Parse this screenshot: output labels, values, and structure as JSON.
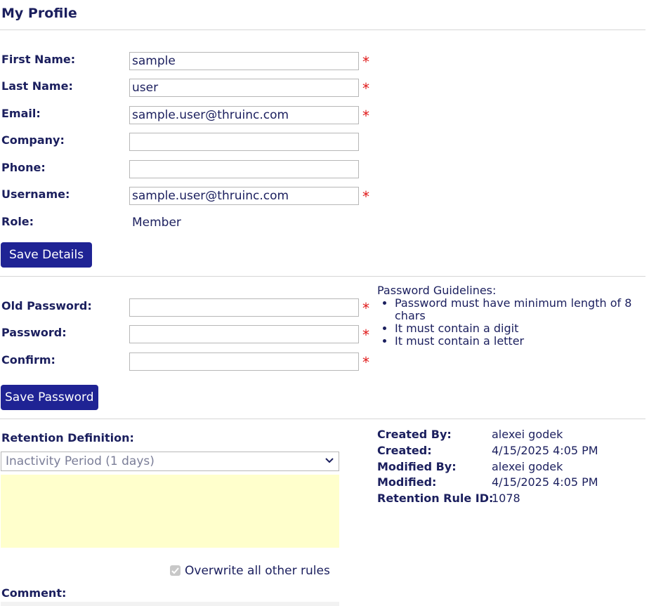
{
  "page": {
    "title": "My Profile"
  },
  "profile": {
    "first_name": {
      "label": "First Name:",
      "value": "sample"
    },
    "last_name": {
      "label": "Last Name:",
      "value": "user"
    },
    "email": {
      "label": "Email:",
      "value": "sample.user@thruinc.com"
    },
    "company": {
      "label": "Company:",
      "value": ""
    },
    "phone": {
      "label": "Phone:",
      "value": ""
    },
    "username": {
      "label": "Username:",
      "value": "sample.user@thruinc.com"
    },
    "role": {
      "label": "Role:",
      "value": "Member"
    },
    "required_mark": "*",
    "save_label": "Save Details"
  },
  "password": {
    "old": {
      "label": "Old Password:",
      "value": ""
    },
    "new": {
      "label": "Password:",
      "value": ""
    },
    "confirm": {
      "label": "Confirm:",
      "value": ""
    },
    "save_label": "Save Password",
    "guidelines_title": "Password Guidelines:",
    "guidelines": [
      "Password must have minimum length of 8 chars",
      "It must contain a digit",
      "It must contain a letter"
    ]
  },
  "retention": {
    "label": "Retention Definition:",
    "selected": "Inactivity Period (1 days)",
    "overwrite_label": "Overwrite all other rules",
    "overwrite_checked": true,
    "comment_label": "Comment:"
  },
  "meta": {
    "created_by": {
      "label": "Created By:",
      "value": "alexei godek"
    },
    "created": {
      "label": "Created:",
      "value": "4/15/2025 4:05 PM"
    },
    "modified_by": {
      "label": "Modified By:",
      "value": "alexei godek"
    },
    "modified": {
      "label": "Modified:",
      "value": "4/15/2025 4:05 PM"
    },
    "rule_id": {
      "label": "Retention Rule ID:",
      "value": "1078"
    }
  },
  "colors": {
    "accent": "#1f2394",
    "text": "#1b1f5e",
    "required": "#e01818",
    "note_bg": "#ffffcc"
  }
}
